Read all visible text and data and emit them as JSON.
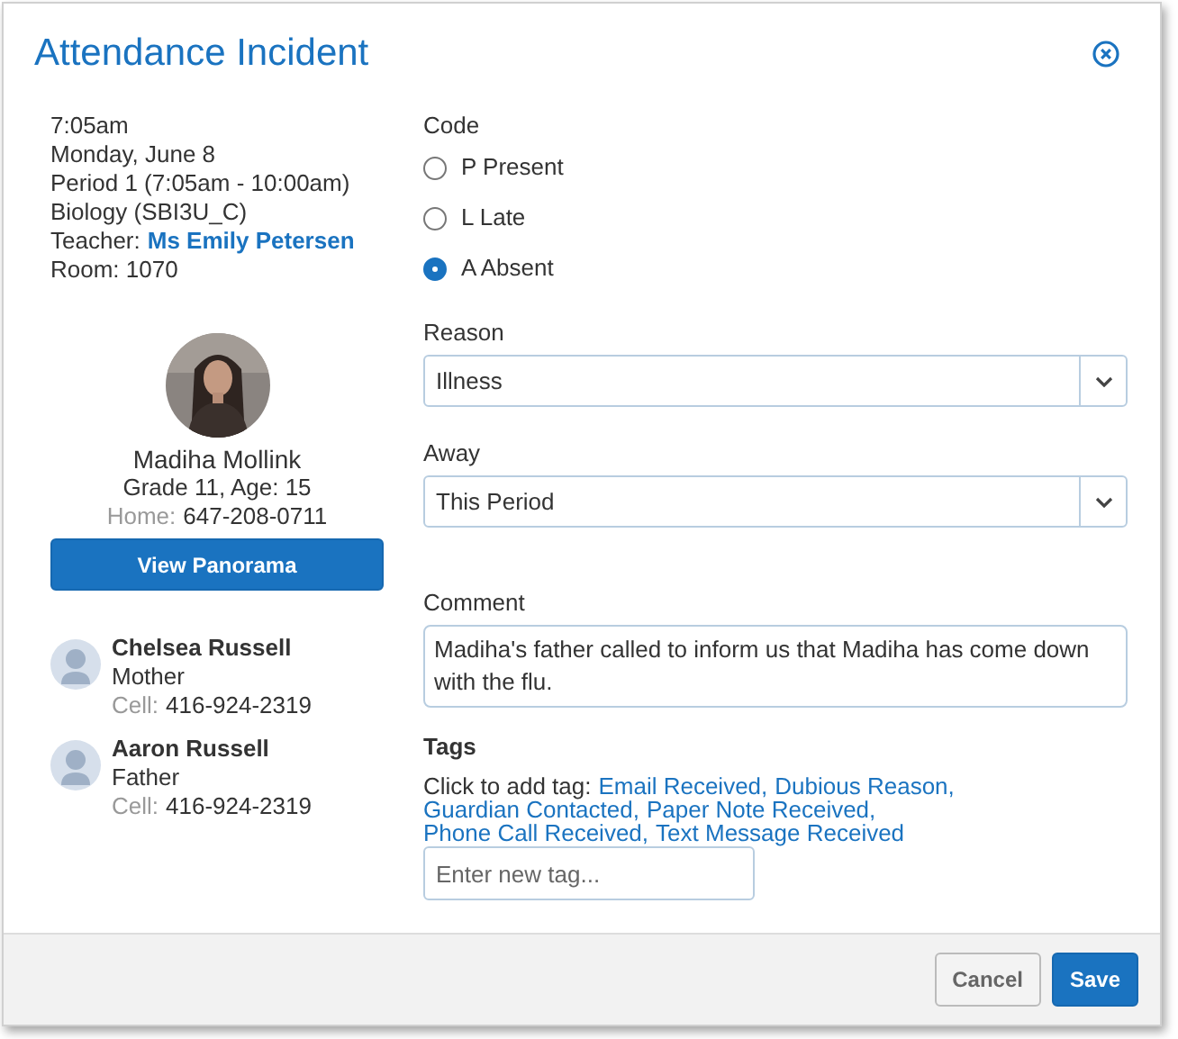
{
  "dialog": {
    "title": "Attendance Incident"
  },
  "lesson": {
    "time": "7:05am",
    "date": "Monday, June 8",
    "period": "Period 1 (7:05am - 10:00am)",
    "course": "Biology (SBI3U_C)",
    "teacher_label": "Teacher:",
    "teacher_name": "Ms Emily Petersen",
    "room": "Room: 1070"
  },
  "student": {
    "name": "Madiha Mollink",
    "grade": "Grade 11, Age: 15",
    "phone_label": "Home:",
    "phone": "647-208-0711",
    "button": "View Panorama"
  },
  "contacts": [
    {
      "name": "Chelsea Russell",
      "relation": "Mother",
      "phone_label": "Cell:",
      "phone": "416-924-2319"
    },
    {
      "name": "Aaron Russell",
      "relation": "Father",
      "phone_label": "Cell:",
      "phone": "416-924-2319"
    }
  ],
  "code": {
    "label": "Code",
    "options": [
      {
        "label": "P Present",
        "selected": false
      },
      {
        "label": "L Late",
        "selected": false
      },
      {
        "label": "A Absent",
        "selected": true
      }
    ]
  },
  "reason": {
    "label": "Reason",
    "value": "Illness"
  },
  "away": {
    "label": "Away",
    "value": "This Period"
  },
  "comment": {
    "label": "Comment",
    "value": "Madiha's father called to inform us that Madiha has come down with the flu."
  },
  "tags": {
    "label": "Tags",
    "prompt": "Click to add tag:",
    "options": [
      "Email Received,",
      "Dubious Reason,",
      "Guardian Contacted,",
      "Paper Note Received,",
      "Phone Call Received,",
      "Text Message Received"
    ],
    "placeholder": "Enter new tag..."
  },
  "buttons": [
    {
      "label": "Cancel",
      "kind": "secondary"
    },
    {
      "label": "Save",
      "kind": "primary"
    }
  ]
}
